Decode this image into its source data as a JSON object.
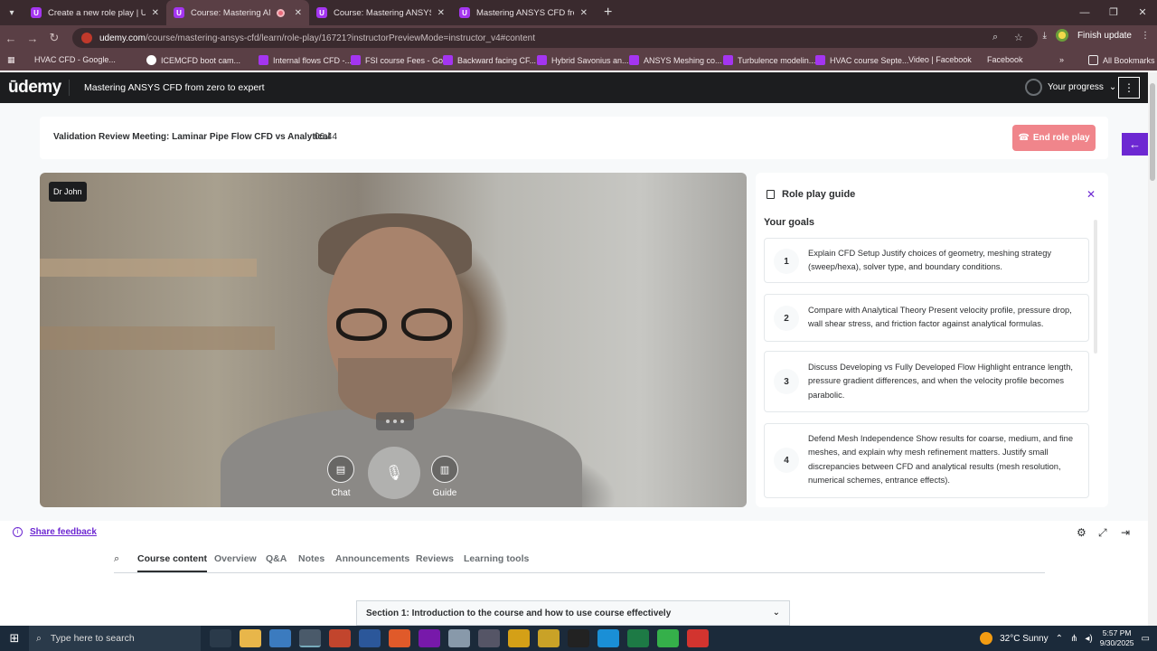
{
  "browser": {
    "tabs": [
      {
        "title": "Create a new role play | Udemy",
        "active": false
      },
      {
        "title": "Course: Mastering ANSYS C",
        "active": true
      },
      {
        "title": "Course: Mastering ANSYS CFD",
        "active": false
      },
      {
        "title": "Mastering ANSYS CFD from zer",
        "active": false
      }
    ],
    "url_host": "udemy.com",
    "url_path": "/course/mastering-ansys-cfd/learn/role-play/16721?instructorPreviewMode=instructor_v4#content",
    "finish_update": "Finish update",
    "bookmarks": [
      {
        "label": "HVAC CFD - Google...",
        "icon": "facebook-icon"
      },
      {
        "label": "ICEMCFD boot cam...",
        "icon": "udemy-icon"
      },
      {
        "label": "Internal flows CFD -...",
        "icon": "udemy-icon"
      },
      {
        "label": "FSI course Fees - Go...",
        "icon": "udemy-icon"
      },
      {
        "label": "Backward facing CF...",
        "icon": "udemy-icon"
      },
      {
        "label": "Hybrid Savonius an...",
        "icon": "udemy-icon"
      },
      {
        "label": "ANSYS Meshing co...",
        "icon": "udemy-icon"
      },
      {
        "label": "Turbulence modelin...",
        "icon": "udemy-icon"
      },
      {
        "label": "HVAC course Septe...",
        "icon": "udemy-icon"
      },
      {
        "label": "Video | Facebook",
        "icon": "facebook-icon"
      },
      {
        "label": "Facebook",
        "icon": "facebook-icon"
      }
    ],
    "all_bookmarks": "All Bookmarks"
  },
  "header": {
    "logo": "ūdemy",
    "course_title": "Mastering ANSYS CFD from zero to expert",
    "progress_label": "Your progress"
  },
  "roleplay": {
    "meeting_title": "Validation Review Meeting: Laminar Pipe Flow CFD vs Analytical",
    "timer": "06:44",
    "end_label": "End role play",
    "speaker": "Dr John",
    "chat_label": "Chat",
    "guide_label": "Guide"
  },
  "guide": {
    "title": "Role play guide",
    "goals_heading": "Your goals",
    "goals": [
      {
        "num": "1",
        "text": "Explain CFD Setup Justify choices of geometry, meshing strategy (sweep/hexa), solver type, and boundary conditions."
      },
      {
        "num": "2",
        "text": "Compare with Analytical Theory Present velocity profile, pressure drop, wall shear stress, and friction factor against analytical formulas."
      },
      {
        "num": "3",
        "text": "Discuss Developing vs Fully Developed Flow Highlight entrance length, pressure gradient differences, and when the velocity profile becomes parabolic."
      },
      {
        "num": "4",
        "text": "Defend Mesh Independence Show results for coarse, medium, and fine meshes, and explain why mesh refinement matters. Justify small discrepancies between CFD and analytical results (mesh resolution, numerical schemes, entrance effects)."
      }
    ]
  },
  "below": {
    "feedback": "Share feedback",
    "tabs": [
      "Course content",
      "Overview",
      "Q&A",
      "Notes",
      "Announcements",
      "Reviews",
      "Learning tools"
    ],
    "section_title": "Section 1: Introduction to the course and how to use course effectively"
  },
  "taskbar": {
    "search_placeholder": "Type here to search",
    "weather": "32°C  Sunny",
    "time": "5:57 PM",
    "date": "9/30/2025"
  },
  "colors": {
    "udemy_purple": "#6d28d2",
    "end_button": "#f0858b",
    "header_dark": "#1c1d1f"
  }
}
